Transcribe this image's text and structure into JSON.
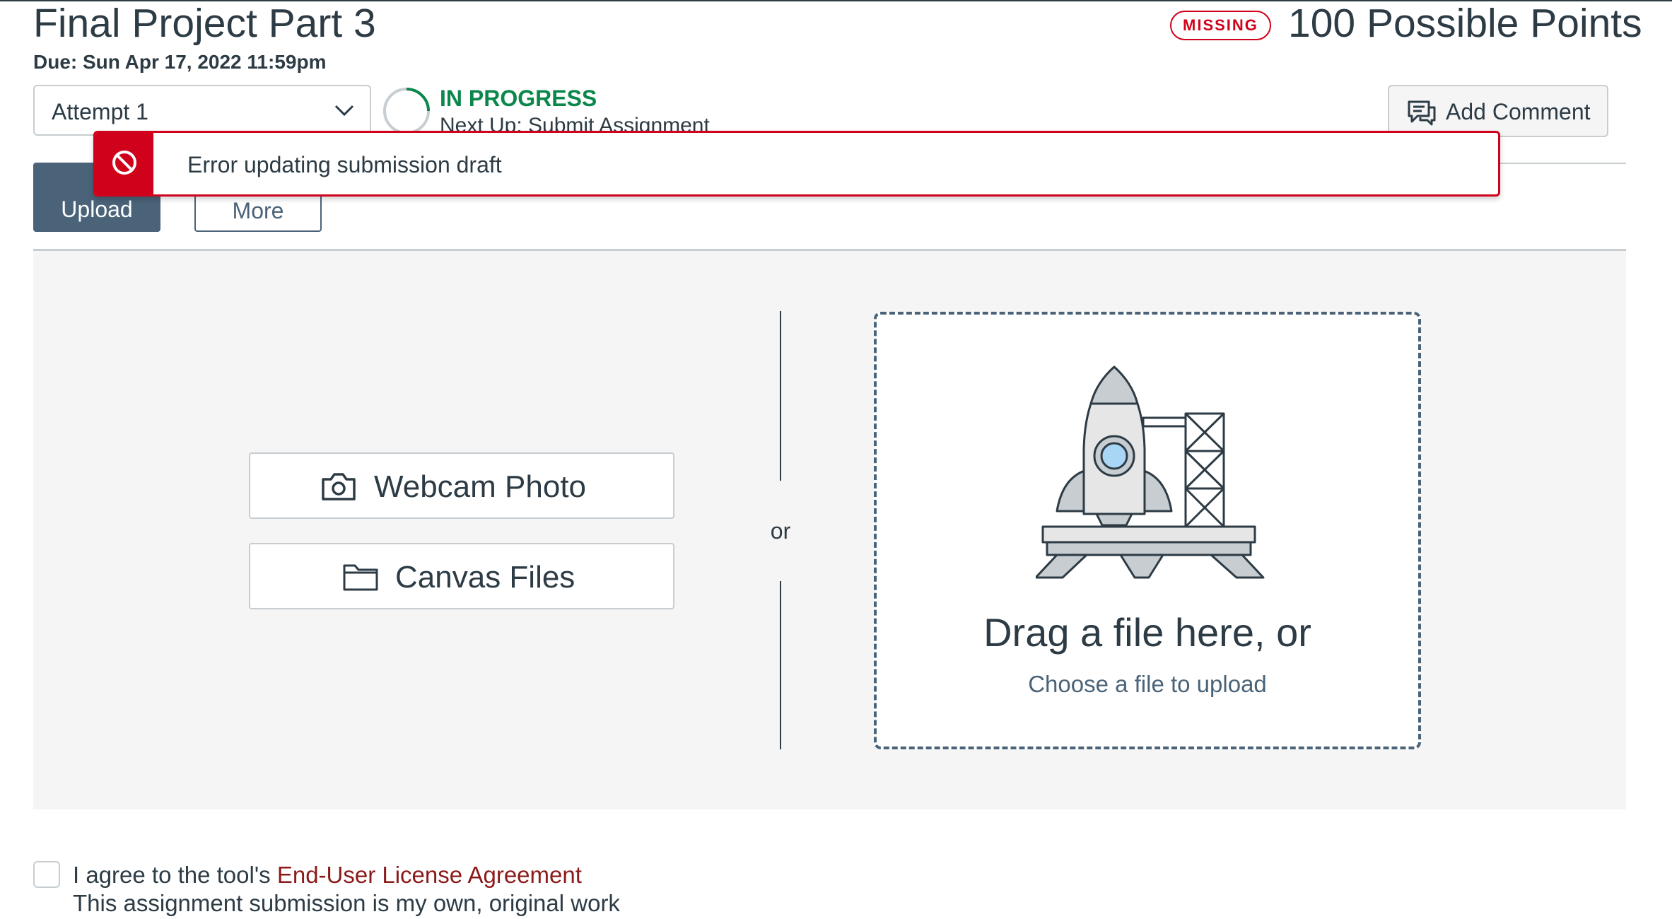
{
  "assignment": {
    "title": "Final Project Part 3",
    "due": "Due: Sun Apr 17, 2022 11:59pm",
    "missing_badge": "MISSING",
    "points": "100 Possible Points"
  },
  "attempt_select": {
    "value": "Attempt 1"
  },
  "progress": {
    "status": "IN PROGRESS",
    "next_up": "Next Up: Submit Assignment"
  },
  "comment": {
    "add_label": "Add Comment"
  },
  "tabs": [
    {
      "label": "Upload",
      "selected": true
    },
    {
      "label": "More",
      "selected": false
    }
  ],
  "alert": {
    "message": "Error updating submission draft",
    "icon": "no-entry-icon"
  },
  "upload_options": {
    "webcam_label": "Webcam Photo",
    "canvas_files_label": "Canvas Files",
    "or_text": "or"
  },
  "dropzone": {
    "title": "Drag a file here, or",
    "link": "Choose a file to upload"
  },
  "agreement": {
    "prefix": "I agree to the tool's ",
    "eula_link": "End-User License Agreement",
    "own_work": "This assignment submission is my own, original work",
    "checked": false
  },
  "colors": {
    "error_red": "#d0021b",
    "success_green": "#0b874b",
    "slate": "#4a6378",
    "text": "#2d3b45",
    "link_maroon": "#8b1a1a"
  }
}
